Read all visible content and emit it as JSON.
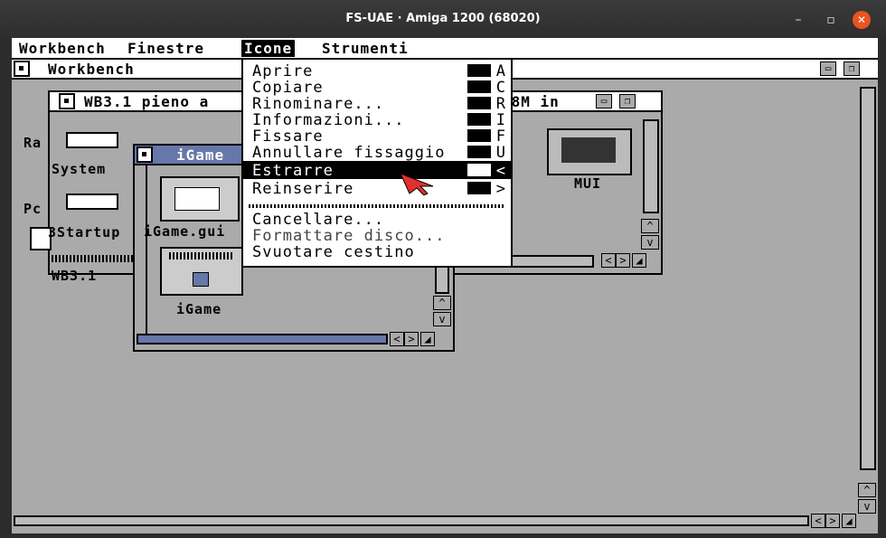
{
  "window": {
    "title": "FS-UAE · Amiga 1200 (68020)",
    "min": "–",
    "max": "▫",
    "close": "✕"
  },
  "menubar": [
    "Workbench",
    "Finestre",
    "Icone",
    "Strumenti"
  ],
  "workbench_title": "Workbench",
  "wb_window": {
    "title_left": "WB3.1  pieno a",
    "title_right": "48M in"
  },
  "desktop_icons": {
    "ram": "Ra",
    "system": "System",
    "pc": "Pc",
    "startup": "3Startup",
    "wb31": "WB3.1",
    "mui": "MUI"
  },
  "igame_window": {
    "title": "iGame",
    "icon1": "iGame.gui",
    "icon2": "iGame"
  },
  "menu": {
    "items": [
      {
        "label": "Aprire",
        "key": "A"
      },
      {
        "label": "Copiare",
        "key": "C"
      },
      {
        "label": "Rinominare...",
        "key": "R"
      },
      {
        "label": "Informazioni...",
        "key": "I"
      },
      {
        "label": "Fissare",
        "key": "F"
      },
      {
        "label": "Annullare fissaggio",
        "key": "U"
      },
      {
        "label": "Estrarre",
        "key": "<",
        "highlighted": true
      },
      {
        "label": "Reinserire",
        "key": ">"
      },
      {
        "label": "Cancellare...",
        "key": ""
      },
      {
        "label": "Formattare disco...",
        "key": "",
        "disabled": true
      },
      {
        "label": "Svuotare cestino",
        "key": ""
      }
    ]
  },
  "arrows": {
    "up": "^",
    "down": "v",
    "left": "<",
    "right": ">"
  }
}
